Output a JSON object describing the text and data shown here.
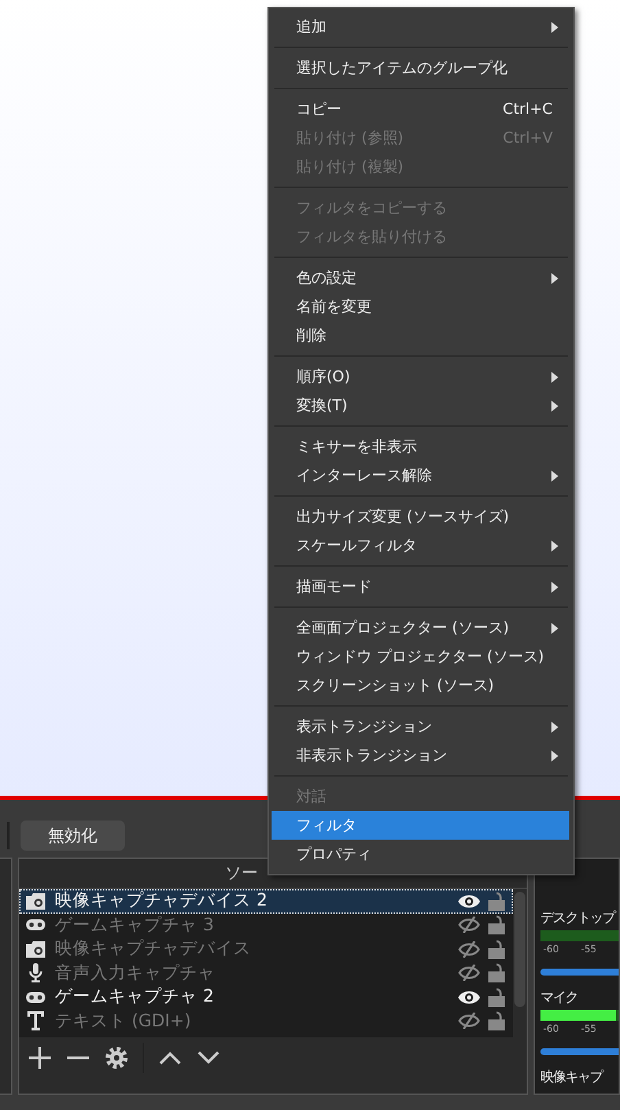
{
  "toolbar": {
    "button": "無効化"
  },
  "sources": {
    "header": "ソー",
    "rows": [
      {
        "name": "映像キャプチャデバイス 2",
        "kind": "camera",
        "visible": true,
        "selected": true
      },
      {
        "name": "ゲームキャプチャ 3",
        "kind": "gamepad",
        "visible": false,
        "selected": false
      },
      {
        "name": "映像キャプチャデバイス",
        "kind": "camera",
        "visible": false,
        "selected": false
      },
      {
        "name": "音声入力キャプチャ",
        "kind": "mic",
        "visible": false,
        "selected": false
      },
      {
        "name": "ゲームキャプチャ 2",
        "kind": "gamepad",
        "visible": true,
        "selected": false
      },
      {
        "name": "テキスト (GDI+)",
        "kind": "text",
        "visible": false,
        "selected": false
      }
    ]
  },
  "mixer": {
    "channels": [
      {
        "name": "デスクトップ",
        "meter": {
          "level": 0
        },
        "ticks": [
          "-60",
          "-55"
        ],
        "fader": {
          "level": 1
        }
      },
      {
        "name": "マイク",
        "meter": {
          "level": 0.92
        },
        "ticks": [
          "-60",
          "-55"
        ],
        "fader": {
          "level": 1
        }
      }
    ],
    "next_label": "映像キャプ"
  },
  "context_menu": {
    "groups": [
      [
        {
          "label": "追加",
          "submenu": true,
          "disabled": false,
          "selected": false
        }
      ],
      [
        {
          "label": "選択したアイテムのグループ化",
          "submenu": false,
          "disabled": false,
          "selected": false
        }
      ],
      [
        {
          "label": "コピー",
          "shortcut": "Ctrl+C",
          "submenu": false,
          "disabled": false,
          "selected": false
        },
        {
          "label": "貼り付け (参照)",
          "shortcut": "Ctrl+V",
          "submenu": false,
          "disabled": true,
          "selected": false
        },
        {
          "label": "貼り付け (複製)",
          "submenu": false,
          "disabled": true,
          "selected": false
        }
      ],
      [
        {
          "label": "フィルタをコピーする",
          "submenu": false,
          "disabled": true,
          "selected": false
        },
        {
          "label": "フィルタを貼り付ける",
          "submenu": false,
          "disabled": true,
          "selected": false
        }
      ],
      [
        {
          "label": "色の設定",
          "submenu": true,
          "disabled": false,
          "selected": false
        },
        {
          "label": "名前を変更",
          "submenu": false,
          "disabled": false,
          "selected": false
        },
        {
          "label": "削除",
          "submenu": false,
          "disabled": false,
          "selected": false
        }
      ],
      [
        {
          "label": "順序(O)",
          "submenu": true,
          "disabled": false,
          "selected": false
        },
        {
          "label": "変換(T)",
          "submenu": true,
          "disabled": false,
          "selected": false
        }
      ],
      [
        {
          "label": "ミキサーを非表示",
          "submenu": false,
          "disabled": false,
          "selected": false
        },
        {
          "label": "インターレース解除",
          "submenu": true,
          "disabled": false,
          "selected": false
        }
      ],
      [
        {
          "label": "出力サイズ変更 (ソースサイズ)",
          "submenu": false,
          "disabled": false,
          "selected": false
        },
        {
          "label": "スケールフィルタ",
          "submenu": true,
          "disabled": false,
          "selected": false
        }
      ],
      [
        {
          "label": "描画モード",
          "submenu": true,
          "disabled": false,
          "selected": false
        }
      ],
      [
        {
          "label": "全画面プロジェクター (ソース)",
          "submenu": true,
          "disabled": false,
          "selected": false
        },
        {
          "label": "ウィンドウ プロジェクター (ソース)",
          "submenu": false,
          "disabled": false,
          "selected": false
        },
        {
          "label": "スクリーンショット (ソース)",
          "submenu": false,
          "disabled": false,
          "selected": false
        }
      ],
      [
        {
          "label": "表示トランジション",
          "submenu": true,
          "disabled": false,
          "selected": false
        },
        {
          "label": "非表示トランジション",
          "submenu": true,
          "disabled": false,
          "selected": false
        }
      ],
      [
        {
          "label": "対話",
          "submenu": false,
          "disabled": true,
          "selected": false
        },
        {
          "label": "フィルタ",
          "submenu": false,
          "disabled": false,
          "selected": true
        },
        {
          "label": "プロパティ",
          "submenu": false,
          "disabled": false,
          "selected": false
        }
      ]
    ]
  }
}
